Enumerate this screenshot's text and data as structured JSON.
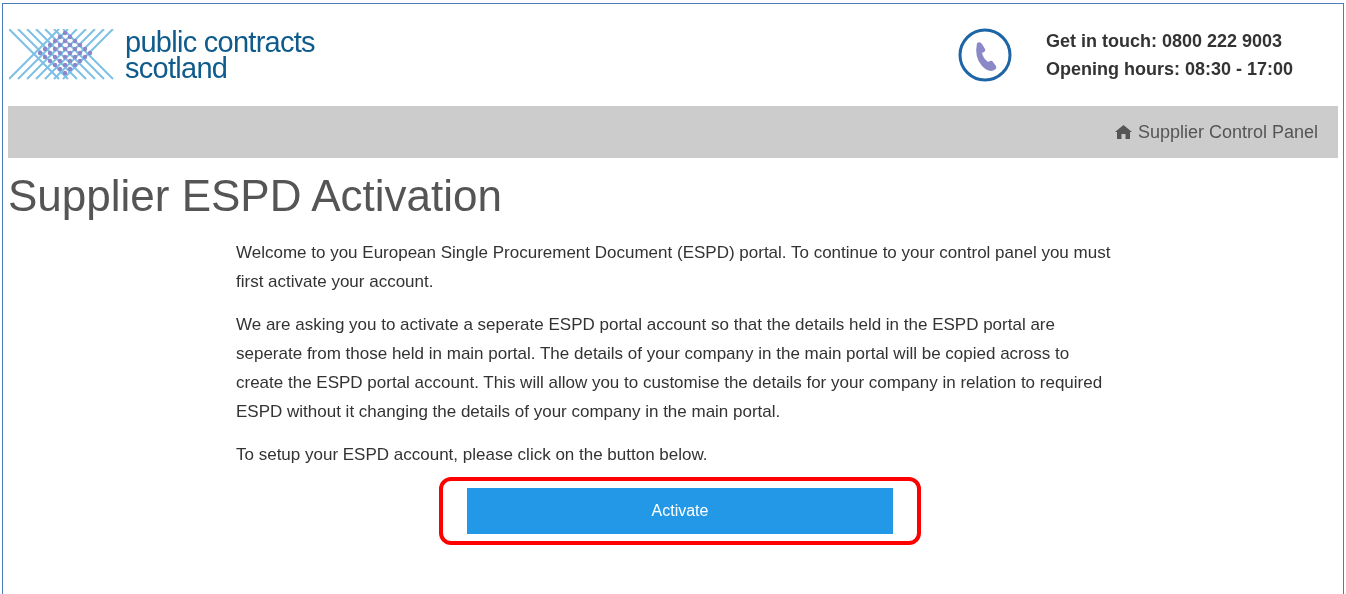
{
  "header": {
    "logo_text": [
      "public contracts",
      "scotland"
    ],
    "contact": [
      "Get in touch: 0800 222 9003",
      "Opening hours: 08:30 - 17:00"
    ]
  },
  "breadcrumb": {
    "label": "Supplier Control Panel"
  },
  "page_title": "Supplier ESPD Activation",
  "paragraphs": [
    "Welcome to you European Single Procurement Document (ESPD) portal. To continue to your control panel you must first activate your account.",
    "We are asking you to activate a seperate ESPD portal account so that the details held in the ESPD portal are seperate from those held in main portal. The details of your company in the main portal will be copied across to create the ESPD portal account. This will allow you to customise the details for your company in relation to required ESPD without it changing the details of your company in the main portal.",
    "To setup your ESPD account, please click on the button below."
  ],
  "activate_button": {
    "label": "Activate",
    "highlighted": true
  }
}
